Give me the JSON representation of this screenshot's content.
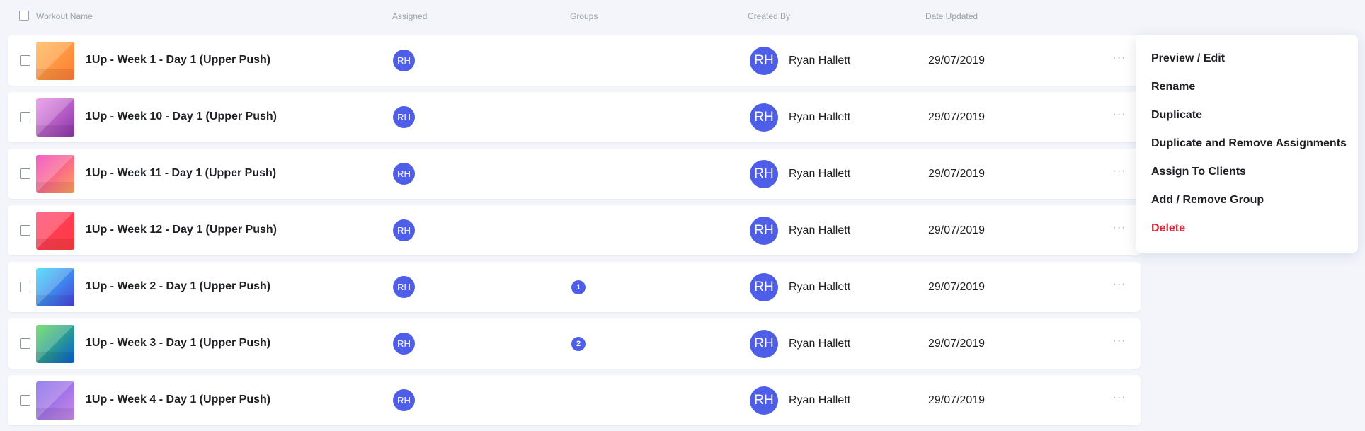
{
  "header": {
    "workout_name": "Workout Name",
    "assigned": "Assigned",
    "groups": "Groups",
    "created_by": "Created By",
    "date_updated": "Date Updated"
  },
  "colors": {
    "accent": "#4f5ee8",
    "danger": "#e3263b",
    "background": "#f3f5fb"
  },
  "rows": [
    {
      "name": "1Up - Week 1 - Day 1 (Upper Push)",
      "assigned_initials": "RH",
      "groups_count": "",
      "creator_initials": "RH",
      "created_by": "Ryan Hallett",
      "date_updated": "29/07/2019",
      "thumb_gradient": [
        "#ffb44a",
        "#ff7b36"
      ]
    },
    {
      "name": "1Up - Week 10 - Day 1 (Upper Push)",
      "assigned_initials": "RH",
      "groups_count": "",
      "creator_initials": "RH",
      "created_by": "Ryan Hallett",
      "date_updated": "29/07/2019",
      "thumb_gradient": [
        "#e98be6",
        "#8a35a8"
      ]
    },
    {
      "name": "1Up - Week 11 - Day 1 (Upper Push)",
      "assigned_initials": "RH",
      "groups_count": "",
      "creator_initials": "RH",
      "created_by": "Ryan Hallett",
      "date_updated": "29/07/2019",
      "thumb_gradient": [
        "#f230b8",
        "#ffa25a"
      ]
    },
    {
      "name": "1Up - Week 12 - Day 1 (Upper Push)",
      "assigned_initials": "RH",
      "groups_count": "",
      "creator_initials": "RH",
      "created_by": "Ryan Hallett",
      "date_updated": "29/07/2019",
      "thumb_gradient": [
        "#ff3d6a",
        "#ff3c3c"
      ]
    },
    {
      "name": "1Up - Week 2 - Day 1 (Upper Push)",
      "assigned_initials": "RH",
      "groups_count": "1",
      "creator_initials": "RH",
      "created_by": "Ryan Hallett",
      "date_updated": "29/07/2019",
      "thumb_gradient": [
        "#2fd7f7",
        "#4c3fe0"
      ]
    },
    {
      "name": "1Up - Week 3 - Day 1 (Upper Push)",
      "assigned_initials": "RH",
      "groups_count": "2",
      "creator_initials": "RH",
      "created_by": "Ryan Hallett",
      "date_updated": "29/07/2019",
      "thumb_gradient": [
        "#4fd94a",
        "#0a5fd6"
      ]
    },
    {
      "name": "1Up - Week 4 - Day 1 (Upper Push)",
      "assigned_initials": "RH",
      "groups_count": "",
      "creator_initials": "RH",
      "created_by": "Ryan Hallett",
      "date_updated": "29/07/2019",
      "thumb_gradient": [
        "#7b5ee8",
        "#c98ae6"
      ]
    }
  ],
  "context_menu": {
    "items": [
      {
        "label": "Preview / Edit",
        "variant": "normal"
      },
      {
        "label": "Rename",
        "variant": "normal"
      },
      {
        "label": "Duplicate",
        "variant": "normal"
      },
      {
        "label": "Duplicate and Remove Assignments",
        "variant": "normal"
      },
      {
        "label": "Assign To Clients",
        "variant": "normal"
      },
      {
        "label": "Add / Remove Group",
        "variant": "normal"
      },
      {
        "label": "Delete",
        "variant": "danger"
      }
    ]
  },
  "icons": {
    "more": "more-horizontal-icon",
    "checkbox": "checkbox-icon"
  }
}
